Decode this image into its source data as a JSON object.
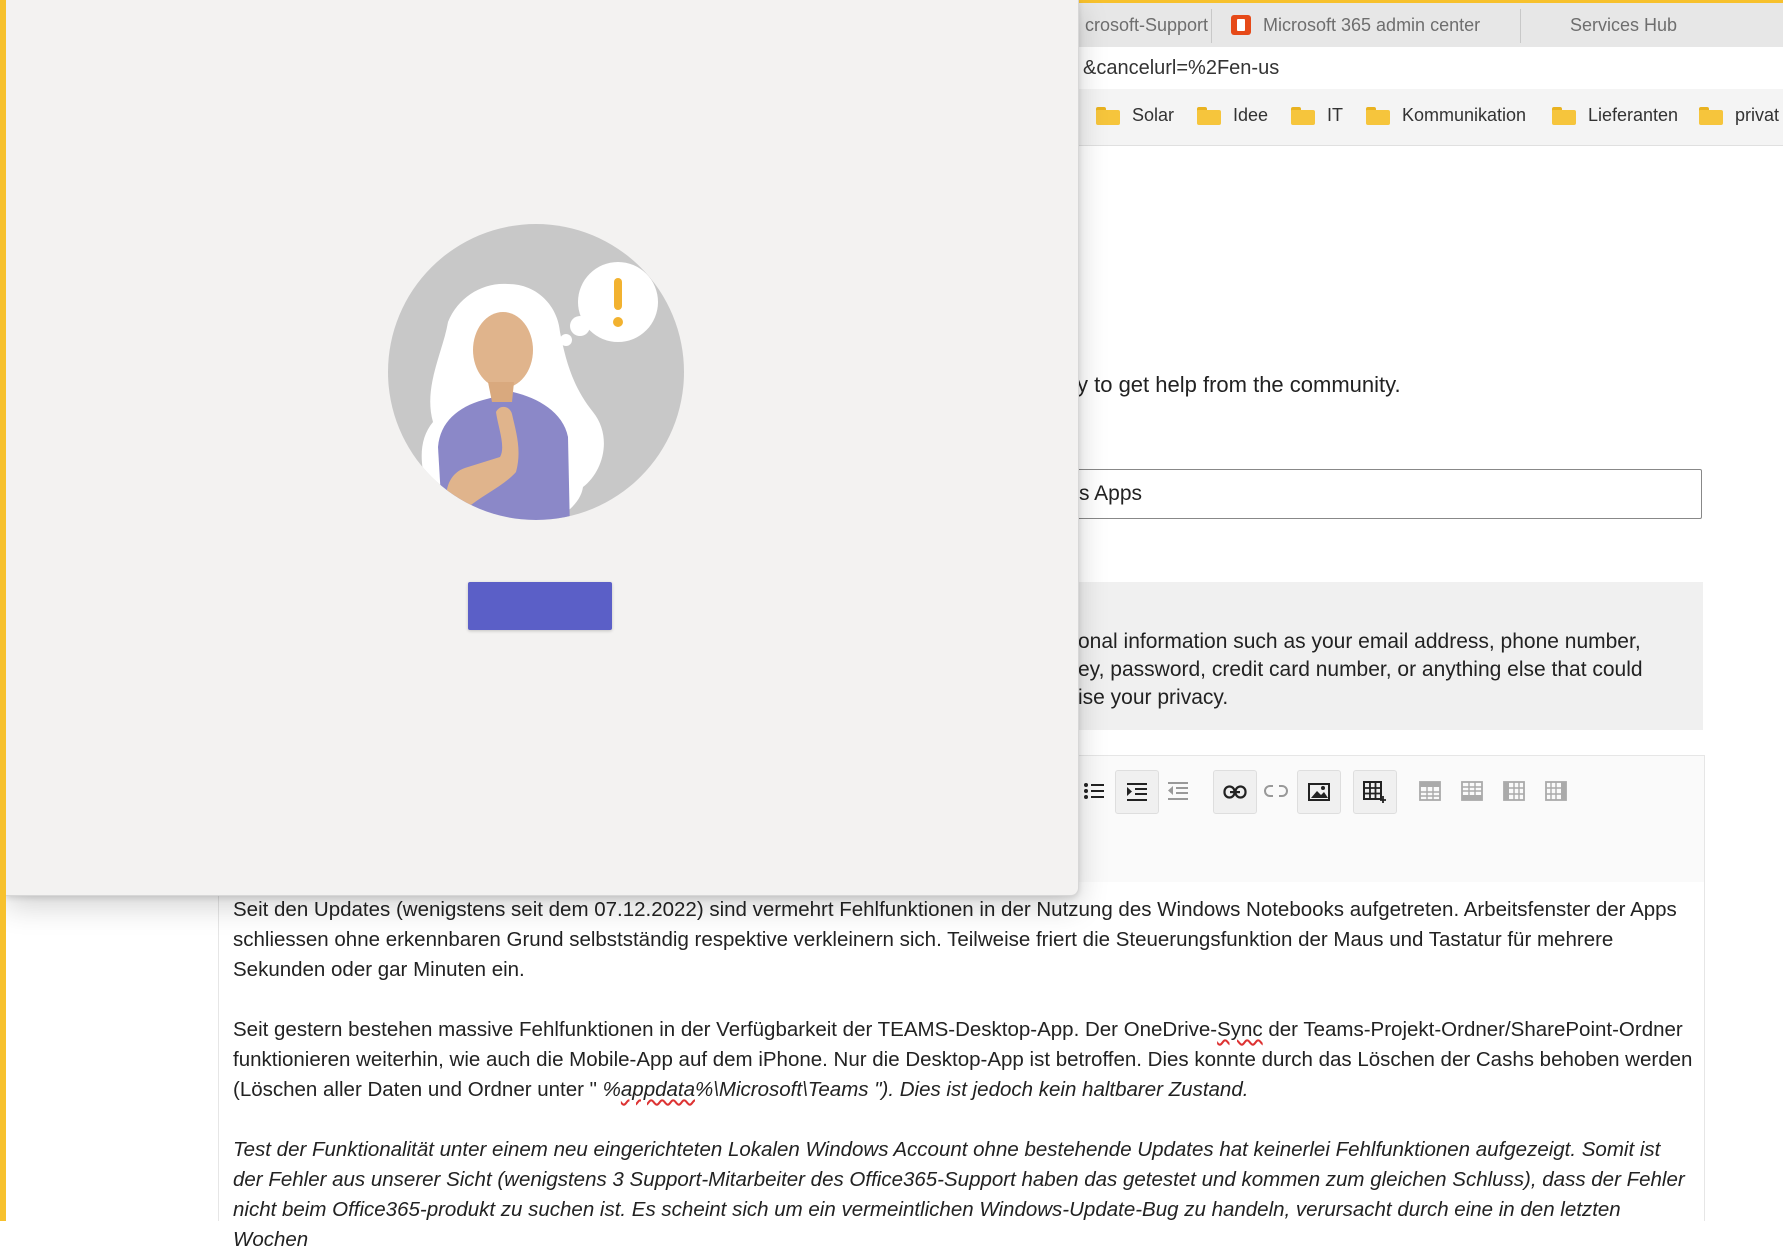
{
  "tabs": [
    {
      "label": "crosoft-Support",
      "icon": "none"
    },
    {
      "label": "Microsoft 365 admin center",
      "icon": "office-icon"
    },
    {
      "label": "Services Hub",
      "icon": "microsoft-logo-icon"
    }
  ],
  "address": {
    "url": "&cancelurl=%2Fen-us"
  },
  "bookmarks": [
    {
      "label": "Solar"
    },
    {
      "label": "Idee"
    },
    {
      "label": "IT"
    },
    {
      "label": "Kommunikation"
    },
    {
      "label": "Lieferanten"
    },
    {
      "label": "privat"
    }
  ],
  "page": {
    "help_text": "y to get help from the community.",
    "product_value": "s Apps",
    "privacy_lines": [
      "onal information such as your email address, phone number,",
      "ey, password, credit card number, or anything else that could",
      "ise your privacy."
    ]
  },
  "editor": {
    "p1": "Seit den Updates (wenigstens seit dem 07.12.2022) sind vermehrt Fehlfunktionen in der Nutzung des Windows Notebooks aufgetreten. Arbeitsfenster der Apps schliessen ohne erkennbaren Grund selbstständig respektive verkleinern sich. Teilweise friert die Steuerungsfunktion der Maus und Tastatur für mehrere Sekunden oder gar Minuten ein.",
    "p2_a": "Seit gestern bestehen massive Fehlfunktionen in der Verfügbarkeit der TEAMS-Desktop-App. Der OneDrive-",
    "p2_sync": "Sync",
    "p2_b": " der Teams-Projekt-Ordner/SharePoint-Ordner funktionieren weiterhin, wie auch die Mobile-App auf dem iPhone. Nur die Desktop-App ist betroffen. Dies konnte durch das Löschen der Cashs behoben werden (Löschen aller Daten und Ordner unter \" ",
    "p2_path_a": "%",
    "p2_path_appdata": "appdata",
    "p2_path_b": "%\\Microsoft\\Teams \"). Dies ist jedoch kein haltbarer Zustand.",
    "p3": "Test der Funktionalität unter einem neu eingerichteten Lokalen Windows Account ohne bestehende Updates hat keinerlei Fehlfunktionen aufgezeigt. Somit ist der Fehler aus unserer Sicht (wenigstens 3 Support-Mitarbeiter des Office365-Support haben das getestet und kommen zum gleichen Schluss), dass der Fehler nicht beim Office365-produkt zu suchen ist. Es scheint sich um ein vermeintlichen Windows-Update-Bug zu handeln, verursacht durch eine in den letzten Wochen"
  },
  "toolbar_icons": [
    "bulleted-list-icon",
    "indent-icon",
    "outdent-icon",
    "link-icon",
    "unlink-icon",
    "image-icon",
    "insert-table-icon",
    "table-row-above-icon",
    "table-row-below-icon",
    "table-column-left-icon",
    "table-column-right-icon"
  ],
  "dialog": {
    "button_label": ""
  },
  "colors": {
    "accent": "#5b5fc7",
    "frame": "#f7c12d",
    "illustration_bg": "#c8c8c8"
  }
}
